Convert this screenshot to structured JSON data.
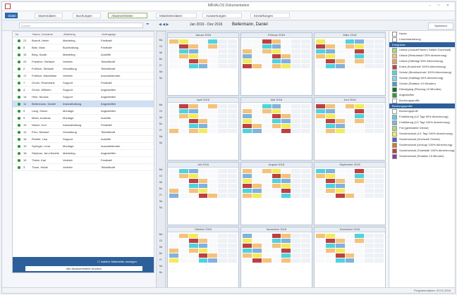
{
  "window": {
    "title": "MÄVALOS Dokumentation",
    "controls": "– □ ✕"
  },
  "menu": {
    "file": "Datei",
    "tabs": [
      "Stammdaten",
      "Buchungen",
      "Abwesenheiten",
      "Mitarbeiterdaten",
      "Auswertungen",
      "Einstellungen"
    ],
    "active_tab_index": 2
  },
  "toolbar": {
    "search_placeholder": "Suchen",
    "nav": "◀ ◀ ▶",
    "range": "Jan 2016 - Dez 2016",
    "person": "Bellermann, Daniel",
    "save_label": "Speichern"
  },
  "employees": {
    "headers": [
      "Nr",
      "Name, Vorname",
      "Abteilung",
      "Vertragstyp"
    ],
    "rows": [
      {
        "nr": "21",
        "name": "Brandt, Helen",
        "dept": "Marketing",
        "type": "Festkraft"
      },
      {
        "nr": "8",
        "name": "Batz, Marc",
        "dept": "Buchhaltung",
        "type": "Festkraft"
      },
      {
        "nr": "15",
        "name": "Berg, Sarah",
        "dept": "Marketing",
        "type": "Aushilfe"
      },
      {
        "nr": "20",
        "name": "Friedrich, Stefanie",
        "dept": "Vertrieb",
        "type": "Teilzeitkraft"
      },
      {
        "nr": "2",
        "name": "Fröhlich, Stefanie",
        "dept": "Verwaltung",
        "type": "Teilzeitkraft"
      },
      {
        "nr": "17",
        "name": "Fröhlich, Maximilian",
        "dept": "Vertrieb",
        "type": "Auszubildender"
      },
      {
        "nr": "7",
        "name": "Gruhn, Rosemarie",
        "dept": "Support",
        "type": "Festkraft"
      },
      {
        "nr": "4",
        "name": "Gruhn, Wilhelm",
        "dept": "Support",
        "type": "Angestellter"
      },
      {
        "nr": "14",
        "name": "Hein, Nicolas",
        "dept": "Support",
        "type": "Angestellter"
      },
      {
        "nr": "11",
        "name": "Bellermann, Daniel",
        "dept": "Instandhaltung",
        "type": "Angestellter"
      },
      {
        "nr": "5",
        "name": "Lang, Simon",
        "dept": "Montage",
        "type": "Angestellter"
      },
      {
        "nr": "9",
        "name": "Meier, Andreas",
        "dept": "Montage",
        "type": "Aushilfe"
      },
      {
        "nr": "13",
        "name": "Nüsch, Kurt",
        "dept": "Instandhaltung",
        "type": "Festkraft"
      },
      {
        "nr": "12",
        "name": "Peru, Michael",
        "dept": "Verwaltung",
        "type": "Teilzeitkraft"
      },
      {
        "nr": "16",
        "name": "Richter, Lisa",
        "dept": "Support",
        "type": "Aushilfe"
      },
      {
        "nr": "19",
        "name": "Springer, Lena",
        "dept": "Montage",
        "type": "Auszubildender"
      },
      {
        "nr": "18",
        "name": "Stephan, Jan-Hendrik",
        "dept": "Marketing",
        "type": "Angestellter"
      },
      {
        "nr": "10",
        "name": "Thiele, Karl",
        "dept": "Vertrieb",
        "type": "Festkraft"
      },
      {
        "nr": "3",
        "name": "Thom, Heide",
        "dept": "Vertrieb",
        "type": "Teilzeitkraft"
      }
    ],
    "selected_index": 9,
    "footer_check": "Inaktive Mitarbeiter anzeigen",
    "footer_button": "Alle Abwesenheiten drucken"
  },
  "weekdays": [
    "Mo",
    "Di",
    "Mi",
    "Do",
    "Fr",
    "Sa",
    "So"
  ],
  "months": [
    "Januar 2016",
    "Februar 2016",
    "März 2016",
    "April 2016",
    "Mai 2016",
    "Juni 2016",
    "Juli 2016",
    "August 2016",
    "September 2016",
    "Oktober 2016",
    "November 2016",
    "Dezember 2016"
  ],
  "colors": {
    "urlaub": "#f6c27a",
    "schule": "#4fd3e0",
    "krank": "#c04040",
    "frei": "#f2eb5a",
    "feiertag": "#7fb2e0"
  },
  "right_panel": {
    "top_items": [
      "Heute",
      "Löschmarkierung"
    ],
    "section1": "Ereignisse",
    "events": [
      {
        "label": "Urlaub (Urlaub/Planen/ Gelber Durchlauf)",
        "color": "#9be07a"
      },
      {
        "label": "Urlaub (Resturlaub/ 25% Abrechnung)",
        "color": "#f6c27a"
      },
      {
        "label": "Urlaub (Halbtag/ 50% Abrechnung)",
        "color": "#e7a15a"
      },
      {
        "label": "Krank (Krankheit/ 100% Abrechnung)",
        "color": "#c04040"
      },
      {
        "label": "Schule (Berufsschule/ 100% Abrechnung)",
        "color": "#4fd3e0"
      },
      {
        "label": "Schule (Halbtag/ 50% Abrechnung)",
        "color": "#7ed9e6"
      },
      {
        "label": "Schule (Rotation 10 Minuten)",
        "color": "#3aa3c9"
      },
      {
        "label": "Dienstgang (Planung 10 Minuten)",
        "color": "#1a6a2a"
      },
      {
        "label": "Angestellter",
        "color": "#2aa02a"
      },
      {
        "label": "Buchungsprofile",
        "color": "#ffffff"
      }
    ],
    "section2": "Buchungsprofile",
    "profiles": [
      {
        "label": "Buchungsprofil",
        "color": "#ffffff"
      },
      {
        "label": "Fortbildung (1/2 Tag/ 50% Abrechnung)",
        "color": "#4fd3e0"
      },
      {
        "label": "Fortbildung (1/1 Tag/ 100% Abrechnung)",
        "color": "#7fb2e0"
      },
      {
        "label": "Frei (geleisteter Dienst)",
        "color": "#9be07a"
      },
      {
        "label": "Sonderurlaub (1/1 Tag/ 100% Abrechnung)",
        "color": "#f2eb5a"
      },
      {
        "label": "Sonderurlaub (Hochzeit/ Geburt)",
        "color": "#5a5ad0"
      },
      {
        "label": "Sonderurlaub (Umzug/ 100% Abrechnung)",
        "color": "#d07a2a"
      },
      {
        "label": "Sonderurlaub (Todesfall/ 100% Abrechnung)",
        "color": "#c04040"
      },
      {
        "label": "Sonderurlaub (Rotation 10 Minuten)",
        "color": "#8a3aa0"
      }
    ]
  },
  "status": {
    "text": "Programmdatum: 20.01.2016"
  }
}
